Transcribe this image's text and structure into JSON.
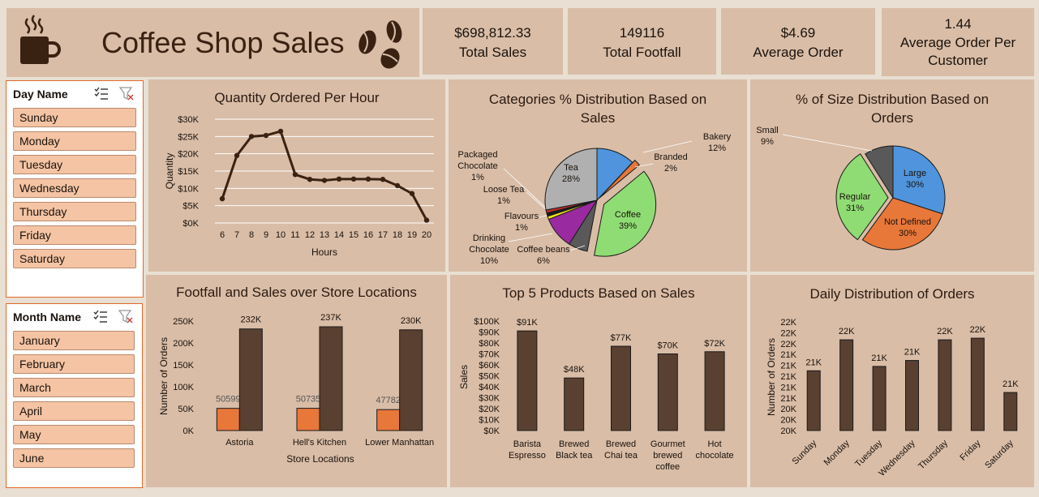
{
  "header": {
    "title": "Coffee Shop Sales",
    "cup_icon": "coffee-cup-icon",
    "beans_icon": "coffee-beans-icon"
  },
  "kpis": [
    {
      "value": "$698,812.33",
      "label": "Total Sales"
    },
    {
      "value": "149116",
      "label": "Total Footfall"
    },
    {
      "value": "$4.69",
      "label": "Average Order"
    },
    {
      "value": "1.44",
      "label": "Average Order Per Customer"
    }
  ],
  "day_slicer": {
    "title": "Day Name",
    "items": [
      "Sunday",
      "Monday",
      "Tuesday",
      "Wednesday",
      "Thursday",
      "Friday",
      "Saturday"
    ]
  },
  "month_slicer": {
    "title": "Month Name",
    "items": [
      "January",
      "February",
      "March",
      "April",
      "May",
      "June"
    ]
  },
  "colors": {
    "brown": "#5a4030",
    "orange": "#e8773a",
    "panel": "#d9bda7"
  },
  "chart_data": [
    {
      "id": "hourly",
      "type": "line",
      "title": "Quantity Ordered Per Hour",
      "xlabel": "Hours",
      "ylabel": "Quantity",
      "x": [
        6,
        7,
        8,
        9,
        10,
        11,
        12,
        13,
        14,
        15,
        16,
        17,
        18,
        19,
        20
      ],
      "values": [
        7000,
        19500,
        25000,
        25300,
        26500,
        14000,
        12600,
        12300,
        12700,
        12700,
        12700,
        12600,
        10800,
        8500,
        800
      ],
      "ylim": [
        0,
        30000
      ],
      "yticks": [
        "$0K",
        "$5K",
        "$10K",
        "$15K",
        "$20K",
        "$25K",
        "$30K"
      ],
      "grid": true
    },
    {
      "id": "categories",
      "type": "pie",
      "title": "Categories % Distribution Based on Sales",
      "slices": [
        {
          "label": "Bakery",
          "value": 12,
          "text": "12%",
          "color": "#4f94dc"
        },
        {
          "label": "Branded",
          "value": 2,
          "text": "2%",
          "color": "#e8773a"
        },
        {
          "label": "Coffee",
          "value": 39,
          "text": "39%",
          "color": "#8fdc74"
        },
        {
          "label": "Coffee beans",
          "value": 6,
          "text": "6%",
          "color": "#595959"
        },
        {
          "label": "Drinking Chocolate",
          "value": 10,
          "text": "10%",
          "color": "#9a2aa0"
        },
        {
          "label": "Flavours",
          "value": 1,
          "text": "1%",
          "color": "#f0e020"
        },
        {
          "label": "Loose Tea",
          "value": 1,
          "text": "1%",
          "color": "#1a1a1a"
        },
        {
          "label": "Packaged Chocolate",
          "value": 1,
          "text": "1%",
          "color": "#c0302a"
        },
        {
          "label": "Tea",
          "value": 28,
          "text": "28%",
          "color": "#b0b0b0"
        }
      ]
    },
    {
      "id": "sizes",
      "type": "pie",
      "title": "% of Size Distribution Based on Orders",
      "slices": [
        {
          "label": "Large",
          "value": 30,
          "text": "30%",
          "color": "#4f94dc"
        },
        {
          "label": "Not Defined",
          "value": 30,
          "text": "30%",
          "color": "#e8773a"
        },
        {
          "label": "Regular",
          "value": 31,
          "text": "31%",
          "color": "#8fdc74"
        },
        {
          "label": "Small",
          "value": 9,
          "text": "9%",
          "color": "#595959"
        }
      ]
    },
    {
      "id": "locations",
      "type": "bar",
      "title": "Footfall and Sales over Store Locations",
      "xlabel": "Store Locations",
      "ylabel": "Number of Orders",
      "categories": [
        "Astoria",
        "Hell's Kitchen",
        "Lower Manhattan"
      ],
      "series": [
        {
          "values": [
            50599,
            50735,
            47782
          ],
          "labels": [
            "50599",
            "50735",
            "47782"
          ],
          "color": "#e8773a"
        },
        {
          "values": [
            232000,
            237000,
            230000
          ],
          "labels": [
            "232K",
            "237K",
            "230K"
          ],
          "color": "#5a4030"
        }
      ],
      "ylim": [
        0,
        250000
      ],
      "yticks": [
        "0K",
        "50K",
        "100K",
        "150K",
        "200K",
        "250K"
      ]
    },
    {
      "id": "products",
      "type": "bar",
      "title": "Top 5 Products Based on Sales",
      "ylabel": "Sales",
      "categories": [
        "Barista Espresso",
        "Brewed Black tea",
        "Brewed Chai tea",
        "Gourmet brewed coffee",
        "Hot chocolate"
      ],
      "values": [
        91000,
        48000,
        77000,
        70000,
        72000
      ],
      "labels": [
        "$91K",
        "$48K",
        "$77K",
        "$70K",
        "$72K"
      ],
      "ylim": [
        0,
        100000
      ],
      "yticks": [
        "$0K",
        "$10K",
        "$20K",
        "$30K",
        "$40K",
        "$50K",
        "$60K",
        "$70K",
        "$80K",
        "$90K",
        "$100K"
      ]
    },
    {
      "id": "daily",
      "type": "bar",
      "title": "Daily Distribution of Orders",
      "ylabel": "Number of Orders",
      "categories": [
        "Sunday",
        "Monday",
        "Tuesday",
        "Wednesday",
        "Thursday",
        "Friday",
        "Saturday"
      ],
      "values": [
        21100,
        21670,
        21180,
        21290,
        21670,
        21700,
        20700
      ],
      "labels": [
        "21K",
        "22K",
        "21K",
        "21K",
        "22K",
        "22K",
        "21K"
      ],
      "ylim": [
        20000,
        22000
      ],
      "yticks": [
        "20K",
        "20K",
        "20K",
        "21K",
        "21K",
        "21K",
        "21K",
        "21K",
        "22K",
        "22K",
        "22K"
      ]
    }
  ]
}
